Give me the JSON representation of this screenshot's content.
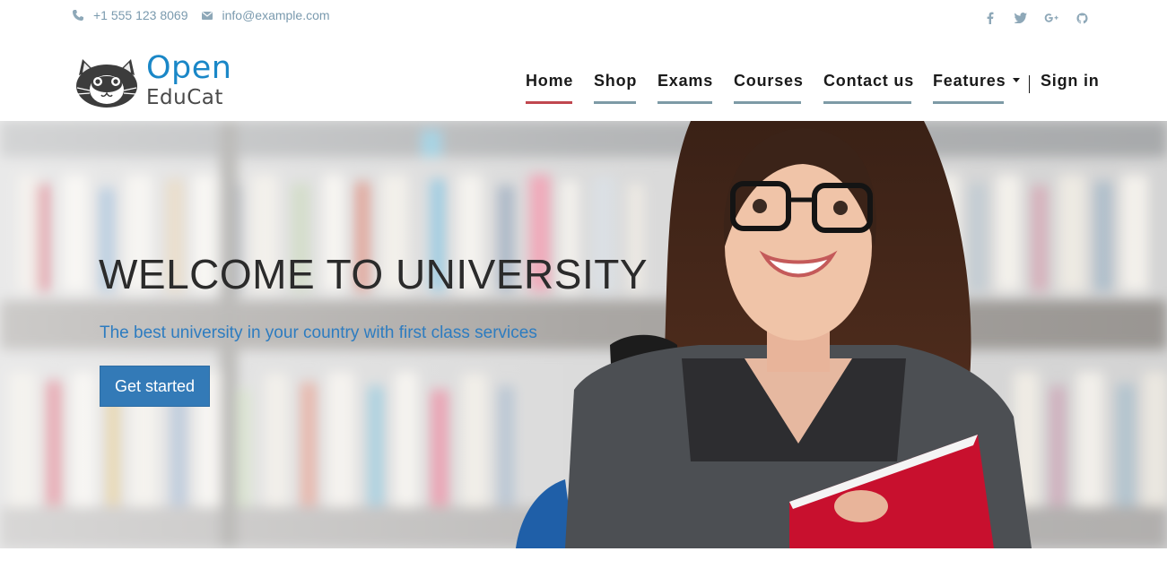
{
  "topbar": {
    "phone": "+1 555 123 8069",
    "email": "info@example.com",
    "icons": [
      "phone-icon",
      "envelope-icon"
    ],
    "social": [
      "facebook-icon",
      "twitter-icon",
      "google-plus-icon",
      "github-icon"
    ]
  },
  "brand": {
    "line1": "Open",
    "line2": "EduCat",
    "mascot": "cat-logo-icon"
  },
  "nav": {
    "items": [
      {
        "label": "Home",
        "active": true
      },
      {
        "label": "Shop",
        "active": false
      },
      {
        "label": "Exams",
        "active": false
      },
      {
        "label": "Courses",
        "active": false
      },
      {
        "label": "Contact us",
        "active": false
      },
      {
        "label": "Features",
        "active": false,
        "dropdown": true
      }
    ],
    "signin": "Sign in"
  },
  "hero": {
    "title": "WELCOME TO UNIVERSITY",
    "subtitle": "The best university in your country with first class services",
    "cta": "Get started"
  },
  "colors": {
    "brand_blue": "#1a87c7",
    "active_underline": "#c0474f",
    "underline": "#7d9aa6",
    "button": "#337ab7",
    "subtitle": "#2d7cc0",
    "muted": "#7a9aae"
  }
}
